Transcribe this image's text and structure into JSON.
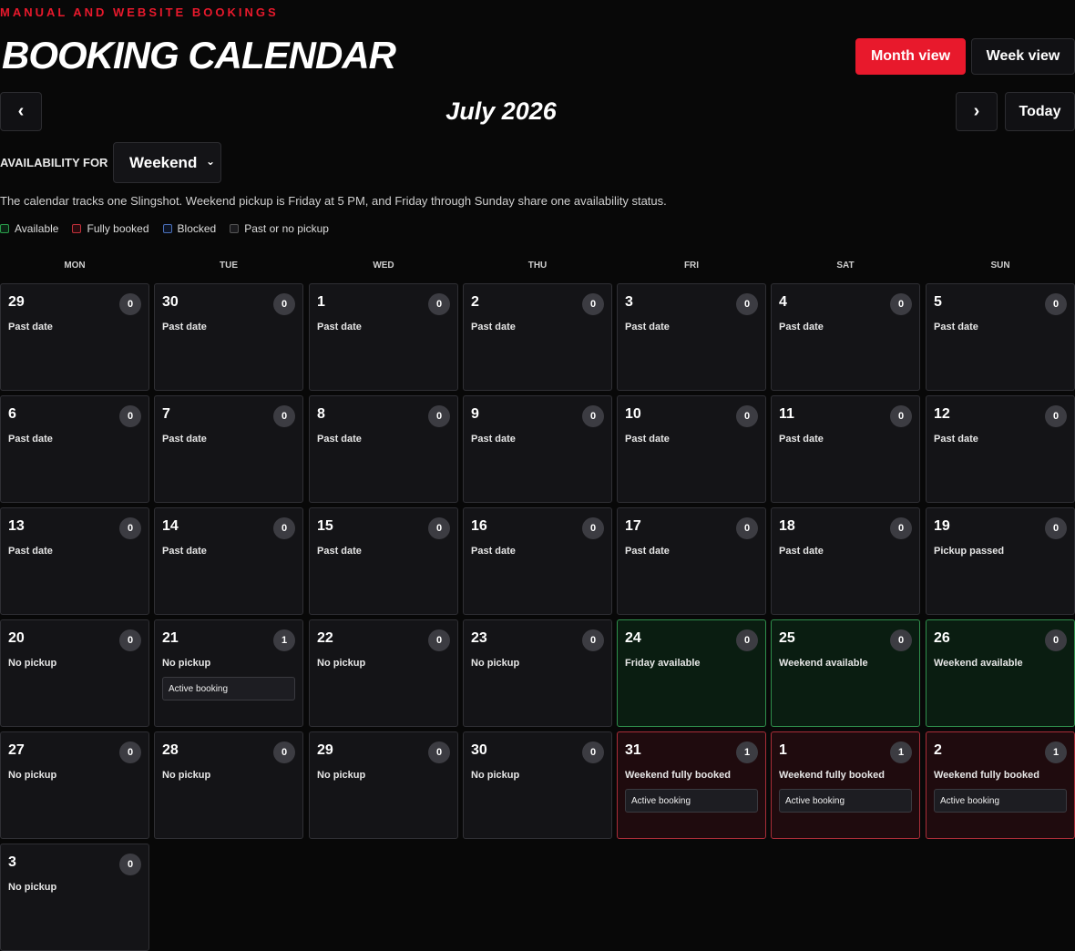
{
  "header": {
    "eyebrow": "MANUAL AND WEBSITE BOOKINGS",
    "title": "BOOKING CALENDAR",
    "month_view": "Month view",
    "week_view": "Week view"
  },
  "nav": {
    "prev": "‹",
    "next": "›",
    "today": "Today",
    "month_label": "July 2026"
  },
  "availability": {
    "label": "AVAILABILITY FOR",
    "selected": "Weekend"
  },
  "description": "The calendar tracks one Slingshot. Weekend pickup is Friday at 5 PM, and Friday through Sunday share one availability status.",
  "legend": [
    "Available",
    "Fully booked",
    "Blocked",
    "Past or no pickup"
  ],
  "days_of_week": [
    "MON",
    "TUE",
    "WED",
    "THU",
    "FRI",
    "SAT",
    "SUN"
  ],
  "cells": [
    {
      "day": "29",
      "count": "0",
      "status": "Past date",
      "booking": "",
      "state": "past"
    },
    {
      "day": "30",
      "count": "0",
      "status": "Past date",
      "booking": "",
      "state": "past"
    },
    {
      "day": "1",
      "count": "0",
      "status": "Past date",
      "booking": "",
      "state": "past"
    },
    {
      "day": "2",
      "count": "0",
      "status": "Past date",
      "booking": "",
      "state": "past"
    },
    {
      "day": "3",
      "count": "0",
      "status": "Past date",
      "booking": "",
      "state": "past"
    },
    {
      "day": "4",
      "count": "0",
      "status": "Past date",
      "booking": "",
      "state": "past"
    },
    {
      "day": "5",
      "count": "0",
      "status": "Past date",
      "booking": "",
      "state": "past"
    },
    {
      "day": "6",
      "count": "0",
      "status": "Past date",
      "booking": "",
      "state": "past"
    },
    {
      "day": "7",
      "count": "0",
      "status": "Past date",
      "booking": "",
      "state": "past"
    },
    {
      "day": "8",
      "count": "0",
      "status": "Past date",
      "booking": "",
      "state": "past"
    },
    {
      "day": "9",
      "count": "0",
      "status": "Past date",
      "booking": "",
      "state": "past"
    },
    {
      "day": "10",
      "count": "0",
      "status": "Past date",
      "booking": "",
      "state": "past"
    },
    {
      "day": "11",
      "count": "0",
      "status": "Past date",
      "booking": "",
      "state": "past"
    },
    {
      "day": "12",
      "count": "0",
      "status": "Past date",
      "booking": "",
      "state": "past"
    },
    {
      "day": "13",
      "count": "0",
      "status": "Past date",
      "booking": "",
      "state": "past"
    },
    {
      "day": "14",
      "count": "0",
      "status": "Past date",
      "booking": "",
      "state": "past"
    },
    {
      "day": "15",
      "count": "0",
      "status": "Past date",
      "booking": "",
      "state": "past"
    },
    {
      "day": "16",
      "count": "0",
      "status": "Past date",
      "booking": "",
      "state": "past"
    },
    {
      "day": "17",
      "count": "0",
      "status": "Past date",
      "booking": "",
      "state": "past"
    },
    {
      "day": "18",
      "count": "0",
      "status": "Past date",
      "booking": "",
      "state": "past"
    },
    {
      "day": "19",
      "count": "0",
      "status": "Pickup passed",
      "booking": "",
      "state": "past"
    },
    {
      "day": "20",
      "count": "0",
      "status": "No pickup",
      "booking": "",
      "state": "past"
    },
    {
      "day": "21",
      "count": "1",
      "status": "No pickup",
      "booking": "Active booking",
      "state": "past"
    },
    {
      "day": "22",
      "count": "0",
      "status": "No pickup",
      "booking": "",
      "state": "past"
    },
    {
      "day": "23",
      "count": "0",
      "status": "No pickup",
      "booking": "",
      "state": "past"
    },
    {
      "day": "24",
      "count": "0",
      "status": "Friday available",
      "booking": "",
      "state": "available"
    },
    {
      "day": "25",
      "count": "0",
      "status": "Weekend available",
      "booking": "",
      "state": "available"
    },
    {
      "day": "26",
      "count": "0",
      "status": "Weekend available",
      "booking": "",
      "state": "available"
    },
    {
      "day": "27",
      "count": "0",
      "status": "No pickup",
      "booking": "",
      "state": "past"
    },
    {
      "day": "28",
      "count": "0",
      "status": "No pickup",
      "booking": "",
      "state": "past"
    },
    {
      "day": "29",
      "count": "0",
      "status": "No pickup",
      "booking": "",
      "state": "past"
    },
    {
      "day": "30",
      "count": "0",
      "status": "No pickup",
      "booking": "",
      "state": "past"
    },
    {
      "day": "31",
      "count": "1",
      "status": "Weekend fully booked",
      "booking": "Active booking",
      "state": "booked"
    },
    {
      "day": "1",
      "count": "1",
      "status": "Weekend fully booked",
      "booking": "Active booking",
      "state": "booked"
    },
    {
      "day": "2",
      "count": "1",
      "status": "Weekend fully booked",
      "booking": "Active booking",
      "state": "booked"
    },
    {
      "day": "3",
      "count": "0",
      "status": "No pickup",
      "booking": "",
      "state": "past"
    }
  ]
}
